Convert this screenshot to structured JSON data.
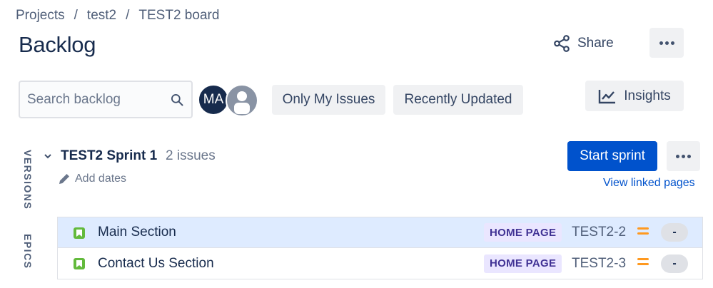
{
  "breadcrumb": {
    "items": [
      "Projects",
      "test2",
      "TEST2 board"
    ],
    "separator": "/"
  },
  "header": {
    "title": "Backlog",
    "share_label": "Share"
  },
  "toolbar": {
    "search_placeholder": "Search backlog",
    "avatar_initials": "MA",
    "filters": [
      "Only My Issues",
      "Recently Updated"
    ],
    "insights_label": "Insights"
  },
  "side_tabs": [
    "VERSIONS",
    "EPICS"
  ],
  "sprint": {
    "name": "TEST2 Sprint 1",
    "issue_count": "2 issues",
    "add_dates_label": "Add dates",
    "start_label": "Start sprint",
    "linked_pages_label": "View linked pages",
    "issues": [
      {
        "summary": "Main Section",
        "epic": "HOME PAGE",
        "key": "TEST2-2",
        "estimate": "-",
        "selected": true
      },
      {
        "summary": "Contact Us Section",
        "epic": "HOME PAGE",
        "key": "TEST2-3",
        "estimate": "-",
        "selected": false
      }
    ]
  },
  "icons": {
    "share": "share-icon",
    "more": "more-icon",
    "search": "search-icon",
    "insights": "chart-icon",
    "chevron": "chevron-down-icon",
    "pencil": "pencil-icon",
    "story": "story-icon",
    "priority": "priority-medium-icon"
  },
  "colors": {
    "primary": "#0052cc",
    "selected_row": "#deebff",
    "story": "#63ba3c",
    "priority_medium": "#ff991f",
    "epic_bg": "#eae6ff",
    "epic_text": "#403294"
  }
}
